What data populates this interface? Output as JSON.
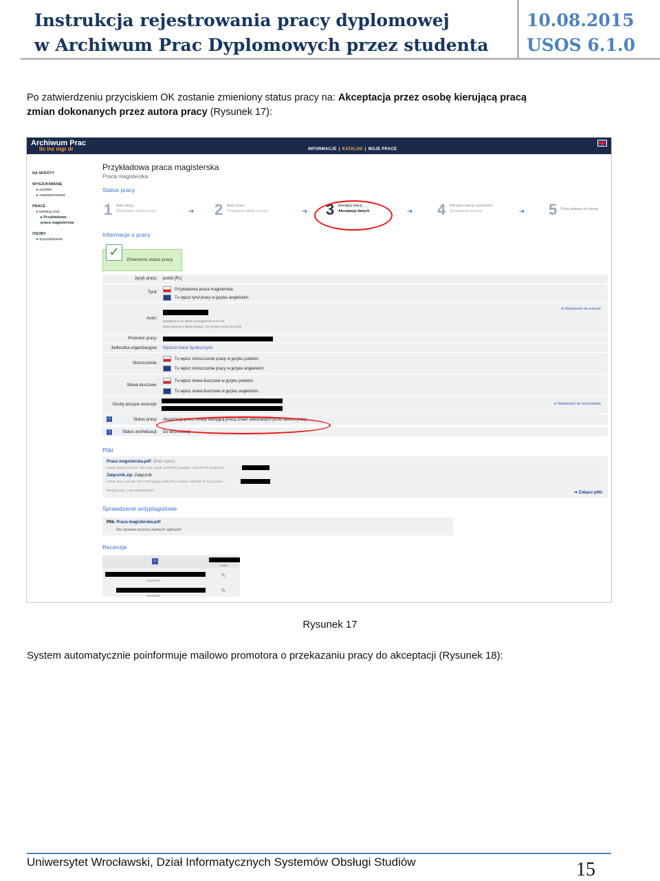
{
  "header": {
    "title_line1": "Instrukcja rejestrowania pracy dyplomowej",
    "title_line2": "w Archiwum Prac Dyplomowych przez studenta",
    "date": "10.08.2015",
    "version": "USOS 6.1.0"
  },
  "intro": {
    "text_a": "Po zatwierdzeniu przyciskiem OK zostanie zmieniony status pracy na: ",
    "text_bold": "Akceptacja przez osobę kierującą pracą",
    "text_b": "zmian dokonanych przez autora pracy",
    "text_c": " (Rysunek 17):"
  },
  "screenshot": {
    "brand": "Archiwum Prac",
    "brand_sub": "lic inz mgr dr",
    "nav": [
      "INFORMACJE",
      "KATALOG",
      "MOJE PRACE"
    ],
    "sidebar": {
      "na_skroty": "NA SKRÓTY",
      "wyszukiwanie": "WYSZUKIWANIE",
      "szybkie": "szybkie",
      "zaawansowane": "zaawansowane",
      "prace": "PRACE",
      "katalog": "katalog prac",
      "przykladowa": "Przykładowa praca magisterska",
      "osoby": "OSOBY",
      "wyszukiwanie2": "wyszukiwanie"
    },
    "page_title": "Przykładowa praca magisterska",
    "page_subtitle": "Praca magisterska",
    "status_heading": "Status pracy",
    "steps": [
      {
        "num": "1",
        "t1": "Autor pracy",
        "t2": "Wypełnianie danych pracy"
      },
      {
        "num": "2",
        "t1": "Autor pracy",
        "t2": "Przesyłanie plików z pracą"
      },
      {
        "num": "3",
        "t1": "Kierujący pracą",
        "t2": "Akceptacja danych"
      },
      {
        "num": "4",
        "t1": "Kierujący pracą i recenzenci",
        "t2": "Wystawianie recenzji"
      },
      {
        "num": "5",
        "t1": "Praca gotowa do obrony",
        "t2": ""
      }
    ],
    "info_heading": "Informacje o pracy",
    "changed_status": "Zmieniono status pracy",
    "rows": {
      "jezyk_lbl": "Język pracy:",
      "jezyk_val": "polski [PL]",
      "tytul_lbl": "Tytuł:",
      "tytul_pl": "Przykładowa praca magisterska",
      "tytul_en": "Tu wpisz tytuł pracy w języku angielskim.",
      "autor_lbl": "Autor:",
      "autor_line1": "Magisterium na WNS na programie EU-K-S3",
      "autor_line2": "Data egzaminu dyplomowego: 10 sierpnia 2015 10:15:43",
      "wiadomosc_autorow": "Wiadomość do autorów",
      "promotor_lbl": "Promotor pracy:",
      "jednostka_lbl": "Jednostka organizacyjna:",
      "jednostka_val": "Wydział Nauk Społecznych",
      "streszczenie_lbl": "Streszczenie:",
      "streszczenie_pl": "Tu wpisz streszczenie pracy w języku polskim.",
      "streszczenie_en": "Tu wpisz streszczenie pracy w języku angielskim.",
      "slowa_lbl": "Słowa kluczowe:",
      "slowa_pl": "Tu wpisz słowa kluczowe w języku polskim.",
      "slowa_en": "Tu wpisz słowa kluczowe w języku angielskim.",
      "osoby_lbl": "Osoby piszące recenzje:",
      "wiadomosc_recenzentow": "Wiadomość do recenzentów",
      "status_lbl": "Status pracy:",
      "status_val": "Akceptacja przez osobę kierującą pracą zmian dokonanych przez autora pracy",
      "archiwizacja_lbl": "Status archiwizacji:",
      "archiwizacja_val": "Do archiwizacji"
    },
    "files_heading": "Pliki",
    "file1_name": "Praca magisterska.pdf:",
    "file1_note": "(brak opisu)",
    "file1_meta": "rodzaj: Praca | rozmiar: 791,1 KB | język: polski [PL] | dodany: 2015-08-10 11:03 przez",
    "file2_name": "Załącznik.zip:",
    "file2_note": "Załącznik",
    "file2_meta": "rodzaj: Inny | rozmiar: 847,7 KB | język: polski [PL] | dodany: 2015-08-10 12:12 przez",
    "versions": "Wersja pracy: 1 (niezatwierdzona)",
    "see_files": "Zobacz pliki",
    "anti_heading": "Sprawdzanie antyplagiatowe",
    "anti_file_lbl": "Plik:",
    "anti_file": "Praca magisterska.pdf",
    "anti_note": "Nie wysłane jeszcze żadnych zgłoszeń",
    "reviews_heading": "Recenzje",
    "rev_autor": "autor",
    "rev_recenzent1": "recenzent",
    "rev_recenzent2": "recenzent"
  },
  "caption": "Rysunek 17",
  "body_text": "System automatycznie poinformuje mailowo promotora o przekazaniu pracy do akceptacji (Rysunek 18):",
  "footer": "Uniwersytet Wrocławski, Dział Informatycznych Systemów Obsługi Studiów",
  "page_number": "15"
}
